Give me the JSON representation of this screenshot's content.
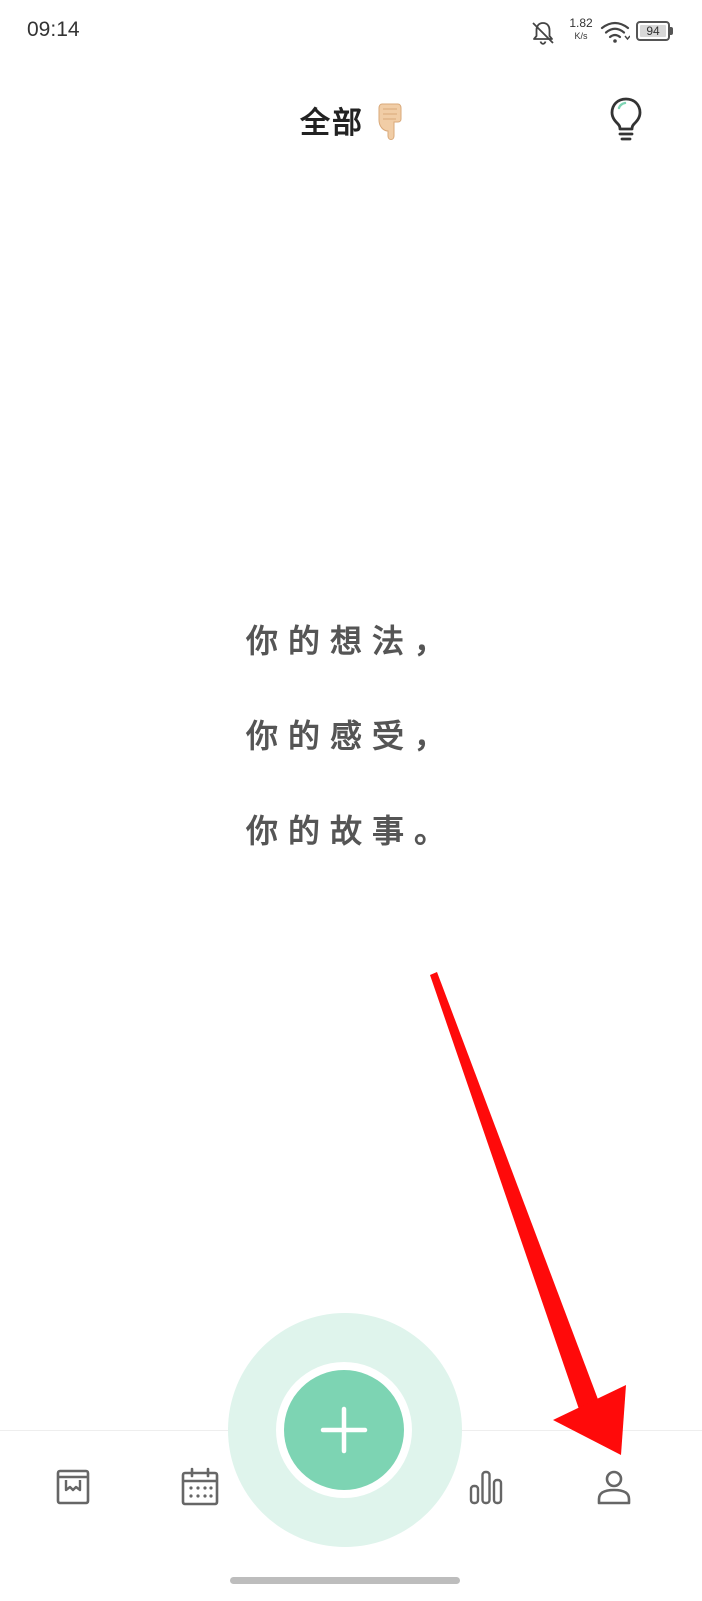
{
  "status_bar": {
    "time": "09:14",
    "net_speed_value": "1.82",
    "net_speed_unit": "K/s",
    "battery": "94",
    "icons": [
      "bell-off-icon",
      "wifi-icon",
      "battery-icon"
    ]
  },
  "header": {
    "title": "全部",
    "title_icon": "pointing-hand-down-icon",
    "action_icon": "lightbulb-icon"
  },
  "empty_state": {
    "lines": [
      "你的想法，",
      "你的感受，",
      "你的故事。"
    ]
  },
  "tab_bar": {
    "tabs": [
      "journal-icon",
      "calendar-icon",
      "add-icon",
      "stats-icon",
      "profile-icon"
    ]
  },
  "annotation": {
    "arrow_color": "#ff0000"
  },
  "colors": {
    "accent": "#7dd4b3",
    "accent_halo": "#dff4ec",
    "text": "#555555"
  }
}
